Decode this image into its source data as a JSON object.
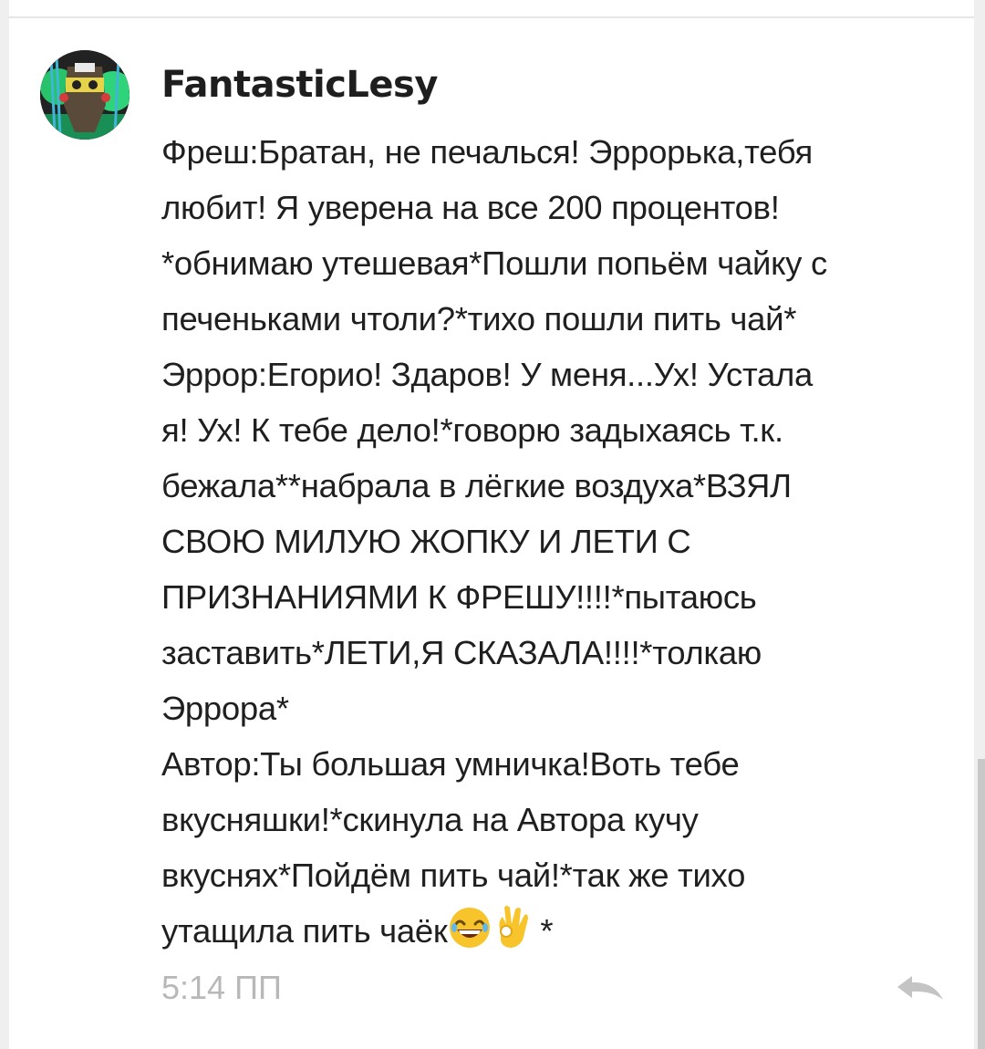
{
  "comment": {
    "author": "FantasticLesy",
    "lines": [
      "Фреш:Братан, не печалься! Эррорька,тебя",
      "любит! Я уверена на все 200 процентов!",
      "*обнимаю утешевая*Пошли попьём чайку с",
      "печеньками чтоли?*тихо пошли пить чай*",
      "Эррор:Егорио! Здаров! У меня...Ух! Устала",
      "я! Ух! К тебе дело!*говорю задыхаясь т.к.",
      "бежала**набрала в лёгкие воздуха*ВЗЯЛ",
      "СВОЮ МИЛУЮ ЖОПКУ И ЛЕТИ С",
      "ПРИЗНАНИЯМИ К ФРЕШУ!!!!*пытаюсь",
      "заставить*ЛЕТИ,Я СКАЗАЛА!!!!*толкаю",
      "Эррора*",
      "Автор:Ты большая умничка!Воть тебе",
      "вкусняшки!*скинула на Автора кучу",
      "вкуснях*Пойдём пить чай!*так же тихо"
    ],
    "last_line": {
      "text": "утащила пить чаёк",
      "emojis": [
        "laughing-emoji",
        "ok-hand-emoji"
      ],
      "tail": " *"
    },
    "timestamp": "5:14 ПП"
  },
  "icons": {
    "reply": "reply-arrow-icon"
  },
  "colors": {
    "text": "#1f1f1f",
    "timestamp": "#b8b8b8",
    "reply_icon": "#c4c4c4",
    "avatar_accent": "#2fc46a"
  }
}
